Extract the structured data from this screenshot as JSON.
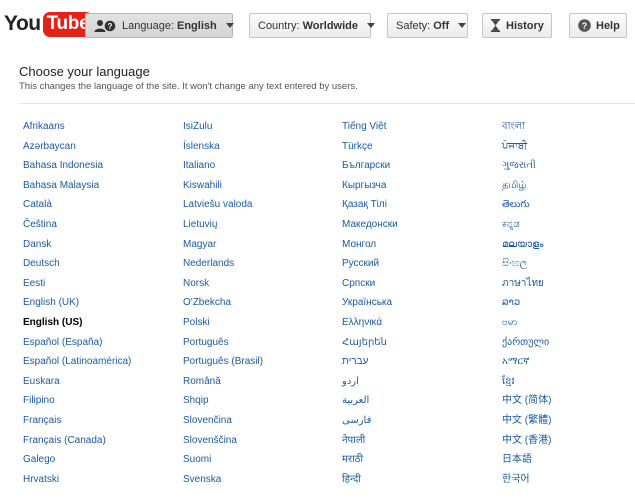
{
  "logo": {
    "you": "You",
    "tube": "Tube"
  },
  "toolbar": {
    "language": {
      "label": "Language:",
      "value": "English"
    },
    "country": {
      "label": "Country:",
      "value": "Worldwide"
    },
    "safety": {
      "label": "Safety:",
      "value": "Off"
    },
    "history": {
      "label": "History"
    },
    "help": {
      "label": "Help"
    }
  },
  "panel": {
    "title": "Choose your language",
    "subtitle": "This changes the language of the site. It won't change any text entered by users."
  },
  "selected_language": "English (US)",
  "columns": [
    [
      "Afrikaans",
      "Azərbaycan",
      "Bahasa Indonesia",
      "Bahasa Malaysia",
      "Català",
      "Čeština",
      "Dansk",
      "Deutsch",
      "Eesti",
      "English (UK)",
      "English (US)",
      "Español (España)",
      "Español (Latinoamérica)",
      "Euskara",
      "Filipino",
      "Français",
      "Français (Canada)",
      "Galego",
      "Hrvatski"
    ],
    [
      "IsiZulu",
      "Íslenska",
      "Italiano",
      "Kiswahili",
      "Latviešu valoda",
      "Lietuvių",
      "Magyar",
      "Nederlands",
      "Norsk",
      "O'Zbekcha",
      "Polski",
      "Português",
      "Português (Brasil)",
      "Română",
      "Shqip",
      "Slovenčina",
      "Slovenščina",
      "Suomi",
      "Svenska"
    ],
    [
      "Tiếng Việt",
      "Türkçe",
      "Български",
      "Кыргызча",
      "Қазақ Тілі",
      "Македонски",
      "Монгол",
      "Русский",
      "Српски",
      "Українська",
      "Ελληνικά",
      "Հայերեն",
      "עברית",
      "اردو",
      "العربية",
      "فارسی",
      "नेपाली",
      "मराठी",
      "हिन्दी"
    ],
    [
      "বাংলা",
      "ਪੰਜਾਬੀ",
      "ગુજરાતી",
      "தமிழ்",
      "తెలుగు",
      "ಕನ್ನಡ",
      "മലയാളം",
      "සිංහල",
      "ภาษาไทย",
      "ລາວ",
      "ဗမာ",
      "ქართული",
      "አማርኛ",
      "ខ្មែរ",
      "中文 (简体)",
      "中文 (繁體)",
      "中文 (香港)",
      "日本語",
      "한국어"
    ]
  ]
}
